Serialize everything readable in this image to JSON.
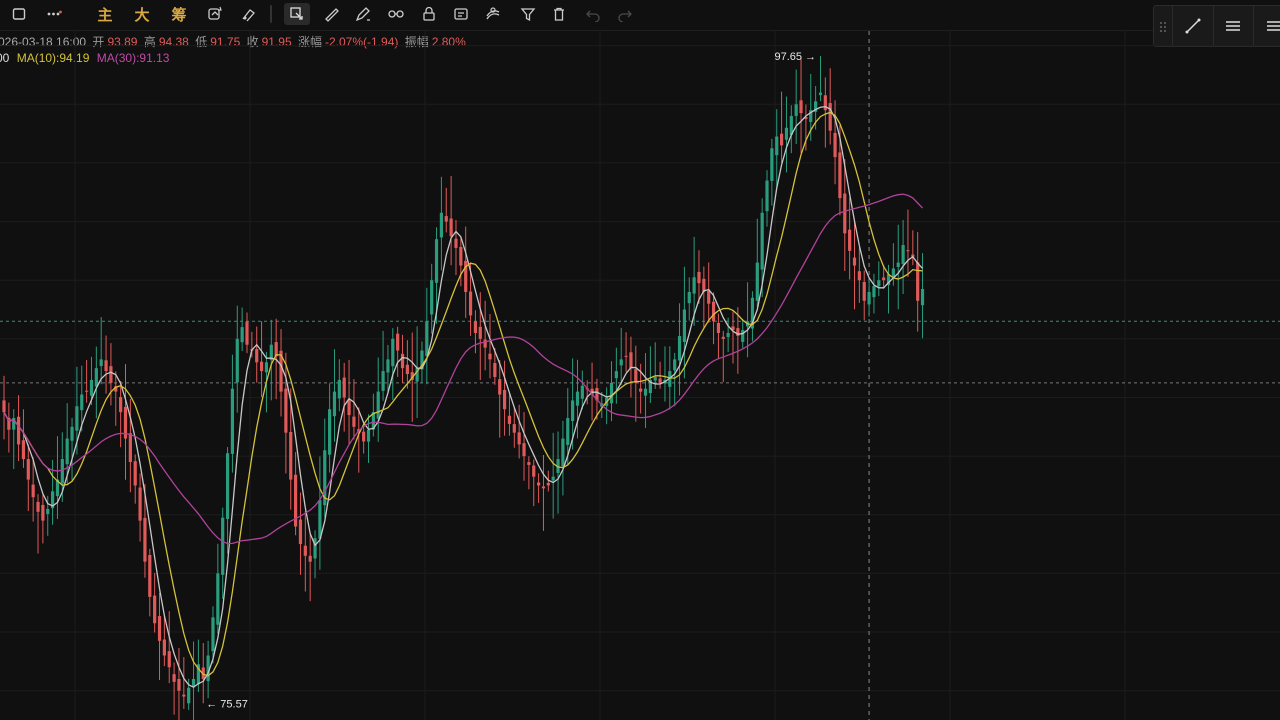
{
  "toolbar": {
    "text_buttons": [
      "主",
      "大",
      "筹"
    ],
    "icons": [
      "square-icon",
      "more-dots-icon",
      "replace-icon",
      "draw-tool-icon",
      "copy-select-icon",
      "ruler-icon",
      "pen-icon",
      "magnet-icon",
      "lock-icon",
      "screenshot-icon",
      "layers-icon",
      "filter-icon",
      "trash-icon",
      "undo-icon",
      "redo-icon"
    ]
  },
  "info": {
    "date": "026-03-18 16:00",
    "open_label": "开",
    "open": "93.89",
    "high_label": "高",
    "high": "94.38",
    "low_label": "低",
    "low": "91.75",
    "close_label": "收",
    "close": "91.95",
    "change_label": "涨幅",
    "change": "-2.07%(-1.94)",
    "amp_label": "振幅",
    "amp": "2.80%"
  },
  "ma": {
    "ma5_tail": "00",
    "ma10": "MA(10):94.19",
    "ma30": "MA(30):91.13"
  },
  "colors": {
    "up": "#2a9d7f",
    "down": "#e05a5a",
    "ma5": "#c8c8c8",
    "ma10": "#d4c23a",
    "ma30": "#b0429a",
    "bg": "#101010",
    "grid": "#1c1c1c",
    "hline": "#3d8c7a"
  },
  "chart_data": {
    "type": "candlestick",
    "ylim": [
      75,
      98.5
    ],
    "max_label": "97.65",
    "min_label": "75.57",
    "max_value": 97.65,
    "min_value": 75.57,
    "max_index": 168,
    "min_index": 41,
    "ref_levels": [
      88.6,
      86.5
    ],
    "crosshair_index": 178,
    "close": [
      85.5,
      84.9,
      85.3,
      84.4,
      83.9,
      83.2,
      82.6,
      82.1,
      81.8,
      82.2,
      82.8,
      83.2,
      83.9,
      84.6,
      85.0,
      85.7,
      86.1,
      86.2,
      86.6,
      87.0,
      87.3,
      86.9,
      86.5,
      86.2,
      85.5,
      84.6,
      83.8,
      83.0,
      81.8,
      80.4,
      79.2,
      78.3,
      77.7,
      77.2,
      76.8,
      76.3,
      76.0,
      75.8,
      76.1,
      76.4,
      76.9,
      76.4,
      77.2,
      78.5,
      80.0,
      81.9,
      84.1,
      86.3,
      88.0,
      88.4,
      87.8,
      87.6,
      87.2,
      86.9,
      87.2,
      87.8,
      87.4,
      86.2,
      84.8,
      83.2,
      81.6,
      81.0,
      80.6,
      80.4,
      81.2,
      82.5,
      84.2,
      85.6,
      86.2,
      86.6,
      86.0,
      85.4,
      85.0,
      84.8,
      84.5,
      84.9,
      85.5,
      86.2,
      86.9,
      87.3,
      88.0,
      87.6,
      87.0,
      86.8,
      86.6,
      87.0,
      87.6,
      88.6,
      90.0,
      91.4,
      92.3,
      92.0,
      91.5,
      91.1,
      90.5,
      89.6,
      88.8,
      88.2,
      88.0,
      87.7,
      87.3,
      86.7,
      86.1,
      85.6,
      85.1,
      84.8,
      84.4,
      84.0,
      83.7,
      83.3,
      83.0,
      82.9,
      83.0,
      83.3,
      83.9,
      84.6,
      85.3,
      85.9,
      86.2,
      86.4,
      86.3,
      86.1,
      85.9,
      85.8,
      86.0,
      86.5,
      86.9,
      87.3,
      87.4,
      87.0,
      86.5,
      86.2,
      86.3,
      86.6,
      86.7,
      86.5,
      86.6,
      86.9,
      87.3,
      88.1,
      89.0,
      89.6,
      90.1,
      89.9,
      89.6,
      89.2,
      88.6,
      88.2,
      88.0,
      88.2,
      88.3,
      88.1,
      88.3,
      88.6,
      89.4,
      90.6,
      92.3,
      93.4,
      94.5,
      94.9,
      94.6,
      95.2,
      95.6,
      96.0,
      95.7,
      95.5,
      95.8,
      96.1,
      96.4,
      95.8,
      95.1,
      94.2,
      92.8,
      91.6,
      91.0,
      90.5,
      90.0,
      89.3,
      89.6,
      89.8,
      90.0,
      90.0,
      90.2,
      90.4,
      90.6,
      91.2,
      91.0,
      90.8,
      89.3,
      89.7
    ]
  }
}
